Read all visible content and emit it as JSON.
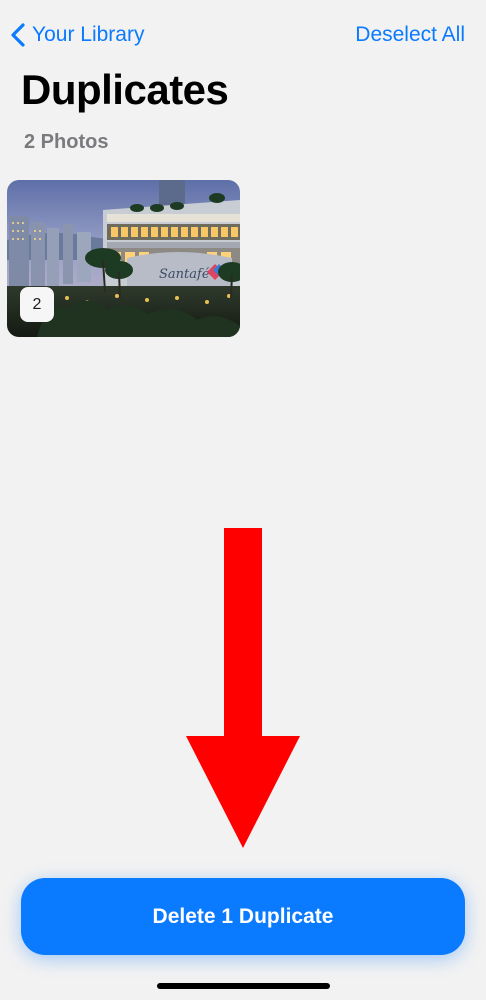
{
  "nav": {
    "back_label": "Your Library",
    "right_action_label": "Deselect All"
  },
  "header": {
    "title": "Duplicates",
    "subtitle": "2 Photos"
  },
  "thumbnail": {
    "count_badge": "2",
    "sign_text": "Santafé"
  },
  "footer": {
    "delete_label": "Delete 1 Duplicate"
  },
  "colors": {
    "accent": "#0a7aff",
    "background": "#f2f2f2",
    "annotation_arrow": "#ff0000"
  },
  "icons": {
    "back": "chevron-left-icon",
    "annotation": "down-arrow-annotation"
  }
}
